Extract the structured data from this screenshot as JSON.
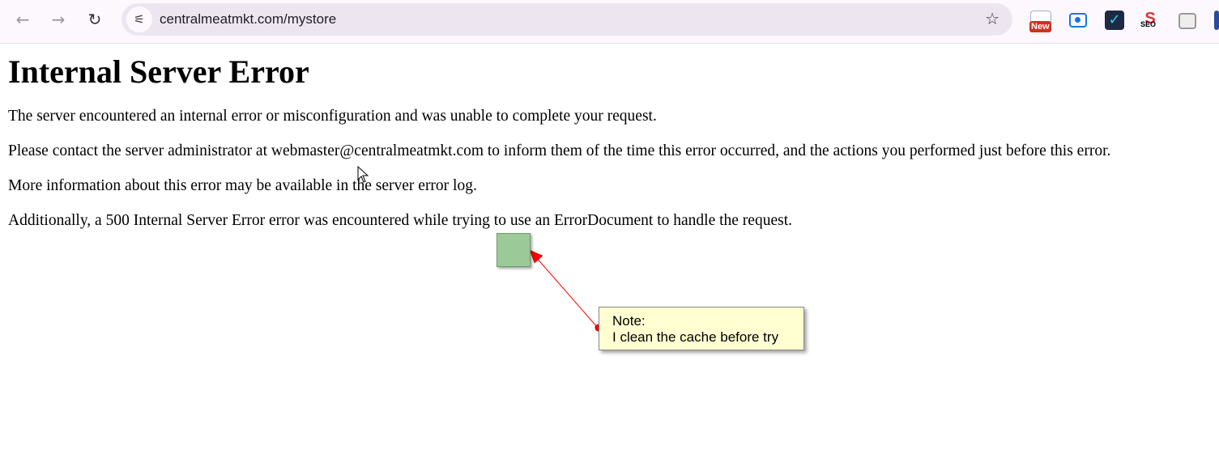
{
  "browser": {
    "url": "centralmeatmkt.com/mystore",
    "extensions": [
      {
        "icon": "new-extension-icon",
        "badge": "New"
      },
      {
        "icon": "screen-record-icon"
      },
      {
        "icon": "checkmark-task-icon"
      },
      {
        "icon": "seo-icon",
        "badge": "SEO"
      },
      {
        "icon": "tab-manager-icon"
      }
    ]
  },
  "page": {
    "title": "Internal Server Error",
    "paragraphs": [
      "The server encountered an internal error or misconfiguration and was unable to complete your request.",
      "Please contact the server administrator at webmaster@centralmeatmkt.com to inform them of the time this error occurred, and the actions you performed just before this error.",
      "More information about this error may be available in the server error log.",
      "Additionally, a 500 Internal Server Error error was encountered while trying to use an ErrorDocument to handle the request."
    ]
  },
  "annotation": {
    "note_title": "Note:",
    "note_text": "I clean the cache before try",
    "highlight_color": "#9bca98",
    "arrow_color": "#ff0000",
    "note_bg": "#ffffd2"
  }
}
